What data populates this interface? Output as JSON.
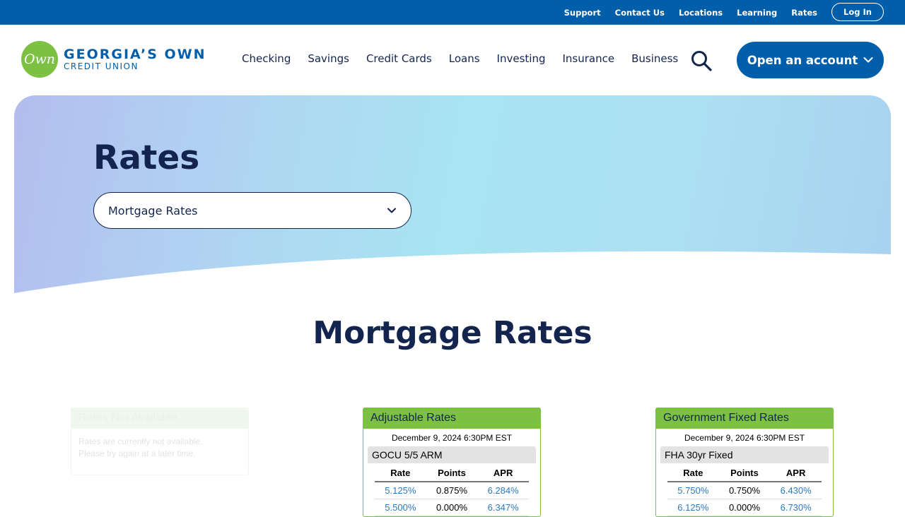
{
  "utility_nav": {
    "links": [
      "Support",
      "Contact Us",
      "Locations",
      "Learning",
      "Rates"
    ],
    "login": "Log In"
  },
  "logo": {
    "mark": "Own",
    "line1": "GEORGIA’S OWN",
    "line2": "CREDIT UNION"
  },
  "main_nav": {
    "items": [
      "Checking",
      "Savings",
      "Credit Cards",
      "Loans",
      "Investing",
      "Insurance",
      "Business"
    ],
    "cta": "Open an account"
  },
  "hero": {
    "title": "Rates",
    "select_value": "Mortgage Rates"
  },
  "section": {
    "title": "Mortgage Rates"
  },
  "cards": {
    "not_available": {
      "title": "Rates Not Available",
      "message": "Rates are currently not available. Please try again at a later time."
    },
    "adjustable": {
      "title": "Adjustable Rates",
      "date": "December 9, 2024 6:30PM EST",
      "product": "GOCU 5/5 ARM",
      "columns": [
        "Rate",
        "Points",
        "APR"
      ],
      "rows": [
        [
          "5.125%",
          "0.875%",
          "6.284%"
        ],
        [
          "5.500%",
          "0.000%",
          "6.347%"
        ]
      ]
    },
    "government": {
      "title": "Government Fixed Rates",
      "date": "December 9, 2024 6:30PM EST",
      "product": "FHA 30yr Fixed",
      "columns": [
        "Rate",
        "Points",
        "APR"
      ],
      "rows": [
        [
          "5.750%",
          "0.750%",
          "6.430%"
        ],
        [
          "6.125%",
          "0.000%",
          "6.730%"
        ]
      ]
    }
  },
  "colors": {
    "brand_blue": "#005eaa",
    "brand_green": "#7cc142",
    "navy_text": "#13254f"
  },
  "icons": [
    "search-icon",
    "chevron-down-icon"
  ]
}
